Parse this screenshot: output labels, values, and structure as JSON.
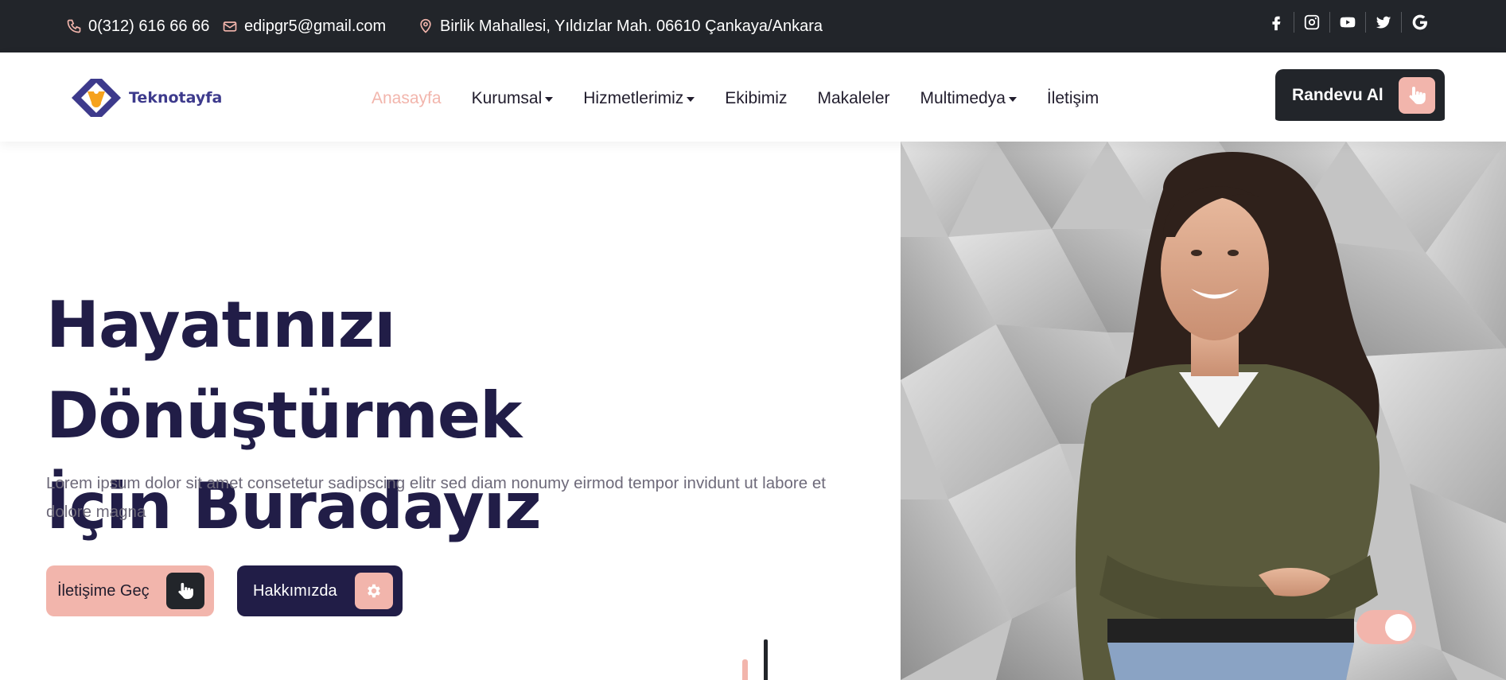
{
  "topbar": {
    "phone": "0(312) 616 66 66",
    "email": "edipgr5@gmail.com",
    "address": "Birlik Mahallesi, Yıldızlar Mah. 06610 Çankaya/Ankara",
    "social_icons": [
      "facebook-icon",
      "instagram-icon",
      "youtube-icon",
      "twitter-icon",
      "google-icon"
    ]
  },
  "brand": {
    "name": "Teknotayfa"
  },
  "nav": {
    "items": [
      {
        "label": "Anasayfa",
        "active": true,
        "dropdown": false
      },
      {
        "label": "Kurumsal",
        "active": false,
        "dropdown": true
      },
      {
        "label": "Hizmetlerimiz",
        "active": false,
        "dropdown": true
      },
      {
        "label": "Ekibimiz",
        "active": false,
        "dropdown": false
      },
      {
        "label": "Makaleler",
        "active": false,
        "dropdown": false
      },
      {
        "label": "Multimedya",
        "active": false,
        "dropdown": true
      },
      {
        "label": "İletişim",
        "active": false,
        "dropdown": false
      }
    ],
    "cta_label": "Randevu Al"
  },
  "hero": {
    "title_line1": "Hayatınızı Dönüştürmek",
    "title_line2": "İçin Buradayız",
    "description": "Lorem ipsum dolor sit amet consetetur sadipscing elitr sed diam nonumy eirmod tempor invidunt ut labore et dolore magna",
    "primary_button": "İletişime Geç",
    "secondary_button": "Hakkımızda"
  },
  "colors": {
    "accent": "#f2b5ac",
    "navy": "#211d47",
    "dark": "#22252a"
  }
}
